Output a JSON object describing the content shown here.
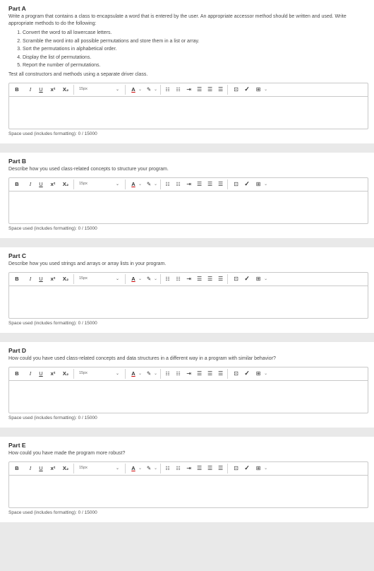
{
  "toolbar": {
    "bold": "B",
    "italic": "I",
    "underline": "U",
    "superscript": "x²",
    "subscript": "X₂",
    "font_size": "15px",
    "caret": "⌄",
    "text_color": "A",
    "highlight": "✎",
    "bullet_list": "☷",
    "numbered_list": "☷",
    "indent": "⇥",
    "align_left": "☰",
    "align_center": "☰",
    "align_right": "☰",
    "image": "⊡",
    "spellcheck": "✓",
    "table": "⊞"
  },
  "parts": [
    {
      "title": "Part A",
      "description": "Write a program that contains a class to encapsulate a word that is entered by the user. An appropriate accessor method should be written and used. Write appropriate methods to do the following:",
      "list": [
        "Convert the word to all lowercase letters.",
        "Scramble the word into all possible permutations and store them in a list or array.",
        "Sort the permutations in alphabetical order.",
        "Display the list of permutations.",
        "Report the number of permutations."
      ],
      "after": "Test all constructors and methods using a separate driver class.",
      "space_used": "Space used (includes formatting): 0 / 15000"
    },
    {
      "title": "Part B",
      "description": "Describe how you used class-related concepts to structure your program.",
      "space_used": "Space used (includes formatting): 0 / 15000"
    },
    {
      "title": "Part C",
      "description": "Describe how you used strings and arrays or array lists in your program.",
      "space_used": "Space used (includes formatting): 0 / 15000"
    },
    {
      "title": "Part D",
      "description": "How could you have used class-related concepts and data structures in a different way in a program with similar behavior?",
      "space_used": "Space used (includes formatting): 0 / 15000"
    },
    {
      "title": "Part E",
      "description": "How could you have made the program more robust?",
      "space_used": "Space used (includes formatting): 0 / 15000"
    }
  ]
}
